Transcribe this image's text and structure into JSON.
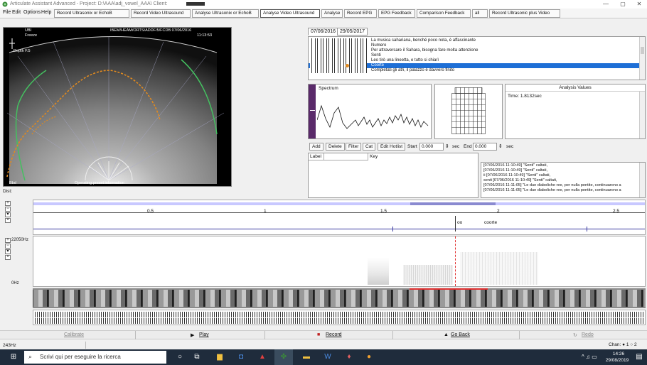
{
  "window": {
    "title": "Articulate Assistant Advanced -     Project: D:\\AAA\\adj_vowel_AAA\\     Client:",
    "minimize": "—",
    "maximize": "▢",
    "close": "✕"
  },
  "menu": {
    "file": "File",
    "edit": "Edit",
    "options": "Options",
    "help": "Help",
    "toolbar_tabs": [
      "Record Ultrasonix or EchoB",
      "Record Video Ultrasound",
      "Analyse Ultrasonix or EchoB",
      "Analyse Video Ultrasound",
      "Analyse",
      "Record EPG",
      "EPG Feedback",
      "Comparison Feedback",
      "all",
      "Record Ultrasonic plus Video"
    ]
  },
  "ultrasound": {
    "header_left": "UBI",
    "header_mid": "Freeze",
    "header_info": "IBEM/HEAM/ORTS/ADDF/5/FCDB  07/06/2016",
    "header_time": "11:13:53",
    "depth_label": "Depth F.5",
    "footer_left": "Bbd",
    "footer_mid": "Operating preset information",
    "dist_label": "Dist:"
  },
  "sessions": [
    "07/06/2016",
    "29/05/2017"
  ],
  "utterances": [
    "La musica sahariana, benché poco nota, è affascinante",
    "Numero",
    "Per attraversare il Sahara, bisogna fare molta attenzione",
    "Senti",
    "Leo tirò una lineetta, e tutto si chiarì",
    "Coorte",
    "Completati gli atri, il palazzo è davvero finito"
  ],
  "selected_utterance_index": 5,
  "spectrum": {
    "title": "Spectrum"
  },
  "analysis": {
    "title": "Analysis Values",
    "time": "Time: 1.8132sec"
  },
  "controls": {
    "add": "Add",
    "delete": "Delete",
    "filter": "Filter",
    "cat": "Cat",
    "edit_hotlist": "Edit Hotlist",
    "start_label": "Start",
    "start_value": "0.000",
    "sec1": "sec",
    "end_label": "End",
    "end_value": "0.000",
    "sec2": "sec",
    "label_header": "Label",
    "key_header": "Key"
  },
  "log": [
    "[07/06/2016 11:10:49] \"Senti\" caltati,",
    "[07/06/2016 11:10:49] \"Senti\" caltati,",
    "ii [07/06/2016 11:10:49] \"Senti\" caltati,",
    "senti [07/06/2016 11:10:49] \"Senti\" caltati,",
    "[07/06/2016 11:11:05] \"Le due diaboliche ree, per nulla pentite, continuarono a",
    "[07/06/2016 11:11:05] \"Le due diaboliche ree, per nulla pentite, continuarono a"
  ],
  "timeline": {
    "ticks": [
      "0.5",
      "1",
      "1.5",
      "2",
      "2.5"
    ],
    "seg_label_1": "oo",
    "seg_label_2": "coorte"
  },
  "spectrogram": {
    "top_freq": "22050Hz",
    "bottom_freq": "0Hz"
  },
  "playbar": {
    "calibrate": "Calibrate",
    "play": "Play",
    "record": "Record",
    "goback": "Go Back",
    "redo": "Redo"
  },
  "status": {
    "freq": "243Hz",
    "channel": "Chan: ● 1 ○ 2"
  },
  "taskbar": {
    "search_placeholder": "Scrivi qui per eseguire la ricerca",
    "time": "14:26",
    "date": "29/08/2019"
  },
  "colors": {
    "accent": "#1e6fd6",
    "cursor": "#e03030",
    "taskbar": "#1f2c3c"
  }
}
